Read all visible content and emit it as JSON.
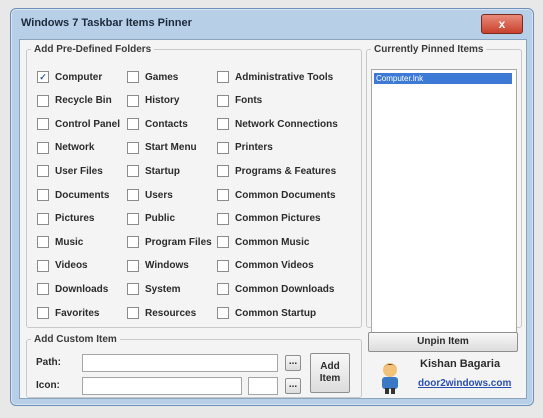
{
  "window": {
    "title": "Windows 7 Taskbar Items Pinner",
    "close_glyph": "x"
  },
  "predefined": {
    "legend": "Add Pre-Defined Folders",
    "col1": [
      {
        "label": "Computer",
        "checked": true
      },
      {
        "label": "Recycle Bin",
        "checked": false
      },
      {
        "label": "Control Panel",
        "checked": false
      },
      {
        "label": "Network",
        "checked": false
      },
      {
        "label": "User Files",
        "checked": false
      },
      {
        "label": "Documents",
        "checked": false
      },
      {
        "label": "Pictures",
        "checked": false
      },
      {
        "label": "Music",
        "checked": false
      },
      {
        "label": "Videos",
        "checked": false
      },
      {
        "label": "Downloads",
        "checked": false
      },
      {
        "label": "Favorites",
        "checked": false
      }
    ],
    "col2": [
      {
        "label": "Games",
        "checked": false
      },
      {
        "label": "History",
        "checked": false
      },
      {
        "label": "Contacts",
        "checked": false
      },
      {
        "label": "Start Menu",
        "checked": false
      },
      {
        "label": "Startup",
        "checked": false
      },
      {
        "label": "Users",
        "checked": false
      },
      {
        "label": "Public",
        "checked": false
      },
      {
        "label": "Program Files",
        "checked": false
      },
      {
        "label": "Windows",
        "checked": false
      },
      {
        "label": "System",
        "checked": false
      },
      {
        "label": "Resources",
        "checked": false
      }
    ],
    "col3": [
      {
        "label": "Administrative Tools",
        "checked": false
      },
      {
        "label": "Fonts",
        "checked": false
      },
      {
        "label": "Network Connections",
        "checked": false
      },
      {
        "label": "Printers",
        "checked": false
      },
      {
        "label": "Programs & Features",
        "checked": false
      },
      {
        "label": "Common Documents",
        "checked": false
      },
      {
        "label": "Common Pictures",
        "checked": false
      },
      {
        "label": "Common Music",
        "checked": false
      },
      {
        "label": "Common Videos",
        "checked": false
      },
      {
        "label": "Common Downloads",
        "checked": false
      },
      {
        "label": "Common Startup",
        "checked": false
      }
    ]
  },
  "pinned": {
    "legend": "Currently Pinned Items",
    "items": [
      "Computer.lnk"
    ],
    "unpin_label": "Unpin Item"
  },
  "custom": {
    "legend": "Add Custom Item",
    "path_label": "Path:",
    "icon_label": "Icon:",
    "path_value": "",
    "icon_value": "",
    "icon_index": "",
    "browse_label": "...",
    "add_label_line1": "Add",
    "add_label_line2": "Item"
  },
  "credits": {
    "author": "Kishan Bagaria",
    "site": "door2windows.com"
  }
}
